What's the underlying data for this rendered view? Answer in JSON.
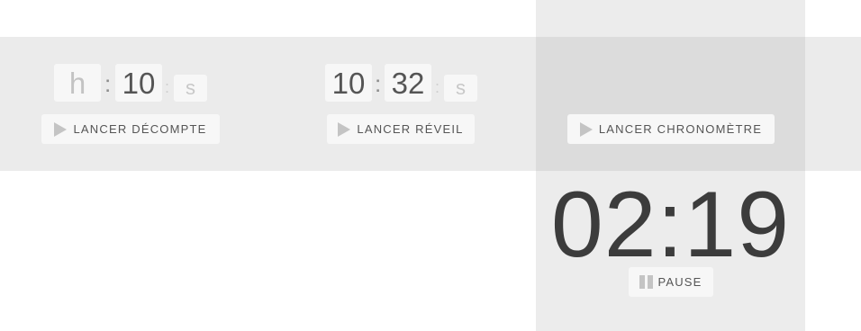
{
  "countdown": {
    "hours_placeholder": "h",
    "minutes_value": "10",
    "seconds_placeholder": "s",
    "separator": ":",
    "start_label": "LANCER DÉCOMPTE"
  },
  "alarm": {
    "hours_value": "10",
    "minutes_value": "32",
    "seconds_placeholder": "s",
    "separator": ":",
    "start_label": "LANCER RÉVEIL"
  },
  "stopwatch": {
    "start_label": "LANCER CHRONOMÈTRE",
    "time_display": "02:19",
    "pause_label": "PAUSE"
  }
}
